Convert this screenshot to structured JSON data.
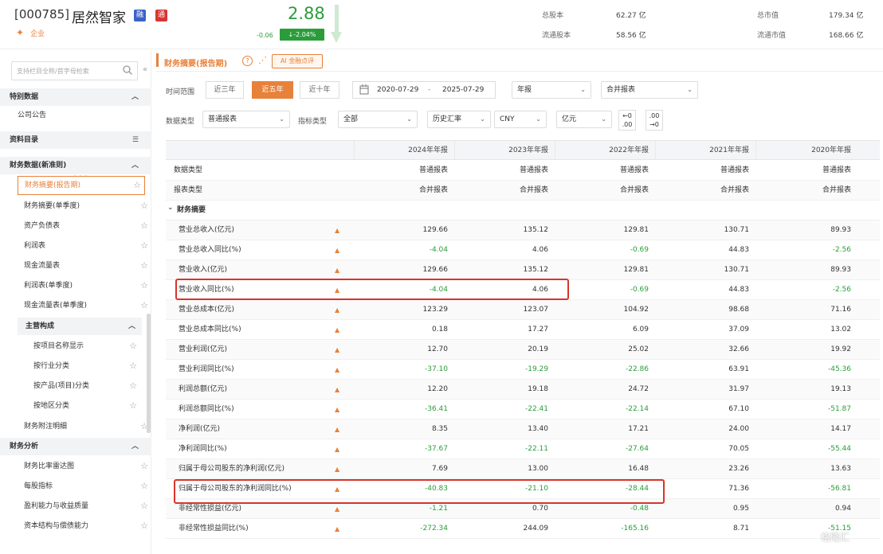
{
  "header": {
    "code": "[000785]",
    "name": "居然智家",
    "badge1": "融",
    "badge2": "通",
    "fav_label": "企业",
    "price": "2.88",
    "change": "-0.06",
    "change_pct": "↓-2.04%",
    "stats": [
      {
        "label": "总股本",
        "value": "62.27 亿"
      },
      {
        "label": "总市值",
        "value": "179.34 亿"
      },
      {
        "label": "流通股本",
        "value": "58.56 亿"
      },
      {
        "label": "流通市值",
        "value": "168.66 亿"
      }
    ]
  },
  "sidebar": {
    "search_placeholder": "支持栏目全称/首字母检索",
    "sections": {
      "announce": "特别数据",
      "announce_item": "公司公告",
      "finance": "资料目录",
      "finance_data": "财务数据(新准则)",
      "analysis": "财务分析"
    },
    "items": [
      {
        "label": "财务摘要(报告期)"
      },
      {
        "label": "财务摘要(单季度)"
      },
      {
        "label": "资产负债表"
      },
      {
        "label": "利润表"
      },
      {
        "label": "现金流量表"
      },
      {
        "label": "利润表(单季度)"
      },
      {
        "label": "现金流量表(单季度)"
      }
    ],
    "subgroup": "主营构成",
    "sub_items": [
      {
        "label": "按项目名称显示"
      },
      {
        "label": "按行业分类"
      },
      {
        "label": "按产品(项目)分类"
      },
      {
        "label": "按地区分类"
      }
    ],
    "notes_item": "财务附注明细",
    "analysis_items": [
      {
        "label": "财务比率雷达图"
      },
      {
        "label": "每股指标"
      },
      {
        "label": "盈利能力与收益质量"
      },
      {
        "label": "资本结构与偿债能力"
      }
    ]
  },
  "main": {
    "tab_title": "财务摘要(报告期)",
    "ai_button": "AI 金融点评",
    "filters": {
      "time_label": "时间范围",
      "ranges": [
        "近三年",
        "近五年",
        "近十年"
      ],
      "date_start": "2020-07-29",
      "date_sep": "-",
      "date_end": "2025-07-29",
      "period": "年报",
      "report_type": "合并报表",
      "data_type_label": "数据类型",
      "data_type": "普通报表",
      "indicator_label": "指标类型",
      "indicator": "全部",
      "rate_type": "历史汇率",
      "currency": "CNY",
      "unit": "亿元",
      "dec_minus": "←0\n.00",
      "dec_plus": ".00\n→0"
    },
    "table": {
      "columns": [
        "2024年年报",
        "2023年年报",
        "2022年年报",
        "2021年年报",
        "2020年年报"
      ],
      "rows": [
        {
          "label": "数据类型",
          "values": [
            "普通报表",
            "普通报表",
            "普通报表",
            "普通报表",
            "普通报表"
          ],
          "flame": false,
          "green": [
            false,
            false,
            false,
            false,
            false
          ]
        },
        {
          "label": "报表类型",
          "values": [
            "合并报表",
            "合并报表",
            "合并报表",
            "合并报表",
            "合并报表"
          ],
          "flame": false,
          "green": [
            false,
            false,
            false,
            false,
            false
          ]
        },
        {
          "label": "财务摘要",
          "values": [
            "",
            "",
            "",
            "",
            ""
          ],
          "flame": false,
          "green": [
            false,
            false,
            false,
            false,
            false
          ],
          "group": true
        },
        {
          "label": "营业总收入(亿元)",
          "values": [
            "129.66",
            "135.12",
            "129.81",
            "130.71",
            "89.93"
          ],
          "flame": true,
          "green": [
            false,
            false,
            false,
            false,
            false
          ]
        },
        {
          "label": "营业总收入同比(%)",
          "values": [
            "-4.04",
            "4.06",
            "-0.69",
            "44.83",
            "-2.56"
          ],
          "flame": true,
          "green": [
            true,
            false,
            true,
            false,
            true
          ]
        },
        {
          "label": "营业收入(亿元)",
          "values": [
            "129.66",
            "135.12",
            "129.81",
            "130.71",
            "89.93"
          ],
          "flame": true,
          "green": [
            false,
            false,
            false,
            false,
            false
          ]
        },
        {
          "label": "营业收入同比(%)",
          "values": [
            "-4.04",
            "4.06",
            "-0.69",
            "44.83",
            "-2.56"
          ],
          "flame": true,
          "green": [
            true,
            false,
            true,
            false,
            true
          ]
        },
        {
          "label": "营业总成本(亿元)",
          "values": [
            "123.29",
            "123.07",
            "104.92",
            "98.68",
            "71.16"
          ],
          "flame": true,
          "green": [
            false,
            false,
            false,
            false,
            false
          ]
        },
        {
          "label": "营业总成本同比(%)",
          "values": [
            "0.18",
            "17.27",
            "6.09",
            "37.09",
            "13.02"
          ],
          "flame": true,
          "green": [
            false,
            false,
            false,
            false,
            false
          ]
        },
        {
          "label": "营业利润(亿元)",
          "values": [
            "12.70",
            "20.19",
            "25.02",
            "32.66",
            "19.92"
          ],
          "flame": true,
          "green": [
            false,
            false,
            false,
            false,
            false
          ]
        },
        {
          "label": "营业利润同比(%)",
          "values": [
            "-37.10",
            "-19.29",
            "-22.86",
            "63.91",
            "-45.36"
          ],
          "flame": true,
          "green": [
            true,
            true,
            true,
            false,
            true
          ]
        },
        {
          "label": "利润总额(亿元)",
          "values": [
            "12.20",
            "19.18",
            "24.72",
            "31.97",
            "19.13"
          ],
          "flame": true,
          "green": [
            false,
            false,
            false,
            false,
            false
          ]
        },
        {
          "label": "利润总额同比(%)",
          "values": [
            "-36.41",
            "-22.41",
            "-22.14",
            "67.10",
            "-51.87"
          ],
          "flame": true,
          "green": [
            true,
            true,
            true,
            false,
            true
          ]
        },
        {
          "label": "净利润(亿元)",
          "values": [
            "8.35",
            "13.40",
            "17.21",
            "24.00",
            "14.17"
          ],
          "flame": true,
          "green": [
            false,
            false,
            false,
            false,
            false
          ]
        },
        {
          "label": "净利润同比(%)",
          "values": [
            "-37.67",
            "-22.11",
            "-27.64",
            "70.05",
            "-55.44"
          ],
          "flame": true,
          "green": [
            true,
            true,
            true,
            false,
            true
          ]
        },
        {
          "label": "归属于母公司股东的净利润(亿元)",
          "values": [
            "7.69",
            "13.00",
            "16.48",
            "23.26",
            "13.63"
          ],
          "flame": true,
          "green": [
            false,
            false,
            false,
            false,
            false
          ]
        },
        {
          "label": "归属于母公司股东的净利润同比(%)",
          "values": [
            "-40.83",
            "-21.10",
            "-28.44",
            "71.36",
            "-56.81"
          ],
          "flame": true,
          "green": [
            true,
            true,
            true,
            false,
            true
          ]
        },
        {
          "label": "非经常性损益(亿元)",
          "values": [
            "-1.21",
            "0.70",
            "-0.48",
            "0.95",
            "0.94"
          ],
          "flame": true,
          "green": [
            true,
            false,
            true,
            false,
            false
          ]
        },
        {
          "label": "非经常性损益同比(%)",
          "values": [
            "-272.34",
            "244.09",
            "-165.16",
            "8.71",
            "-51.15"
          ],
          "flame": true,
          "green": [
            true,
            false,
            true,
            false,
            true
          ]
        }
      ]
    }
  },
  "watermark": "格隆汇"
}
